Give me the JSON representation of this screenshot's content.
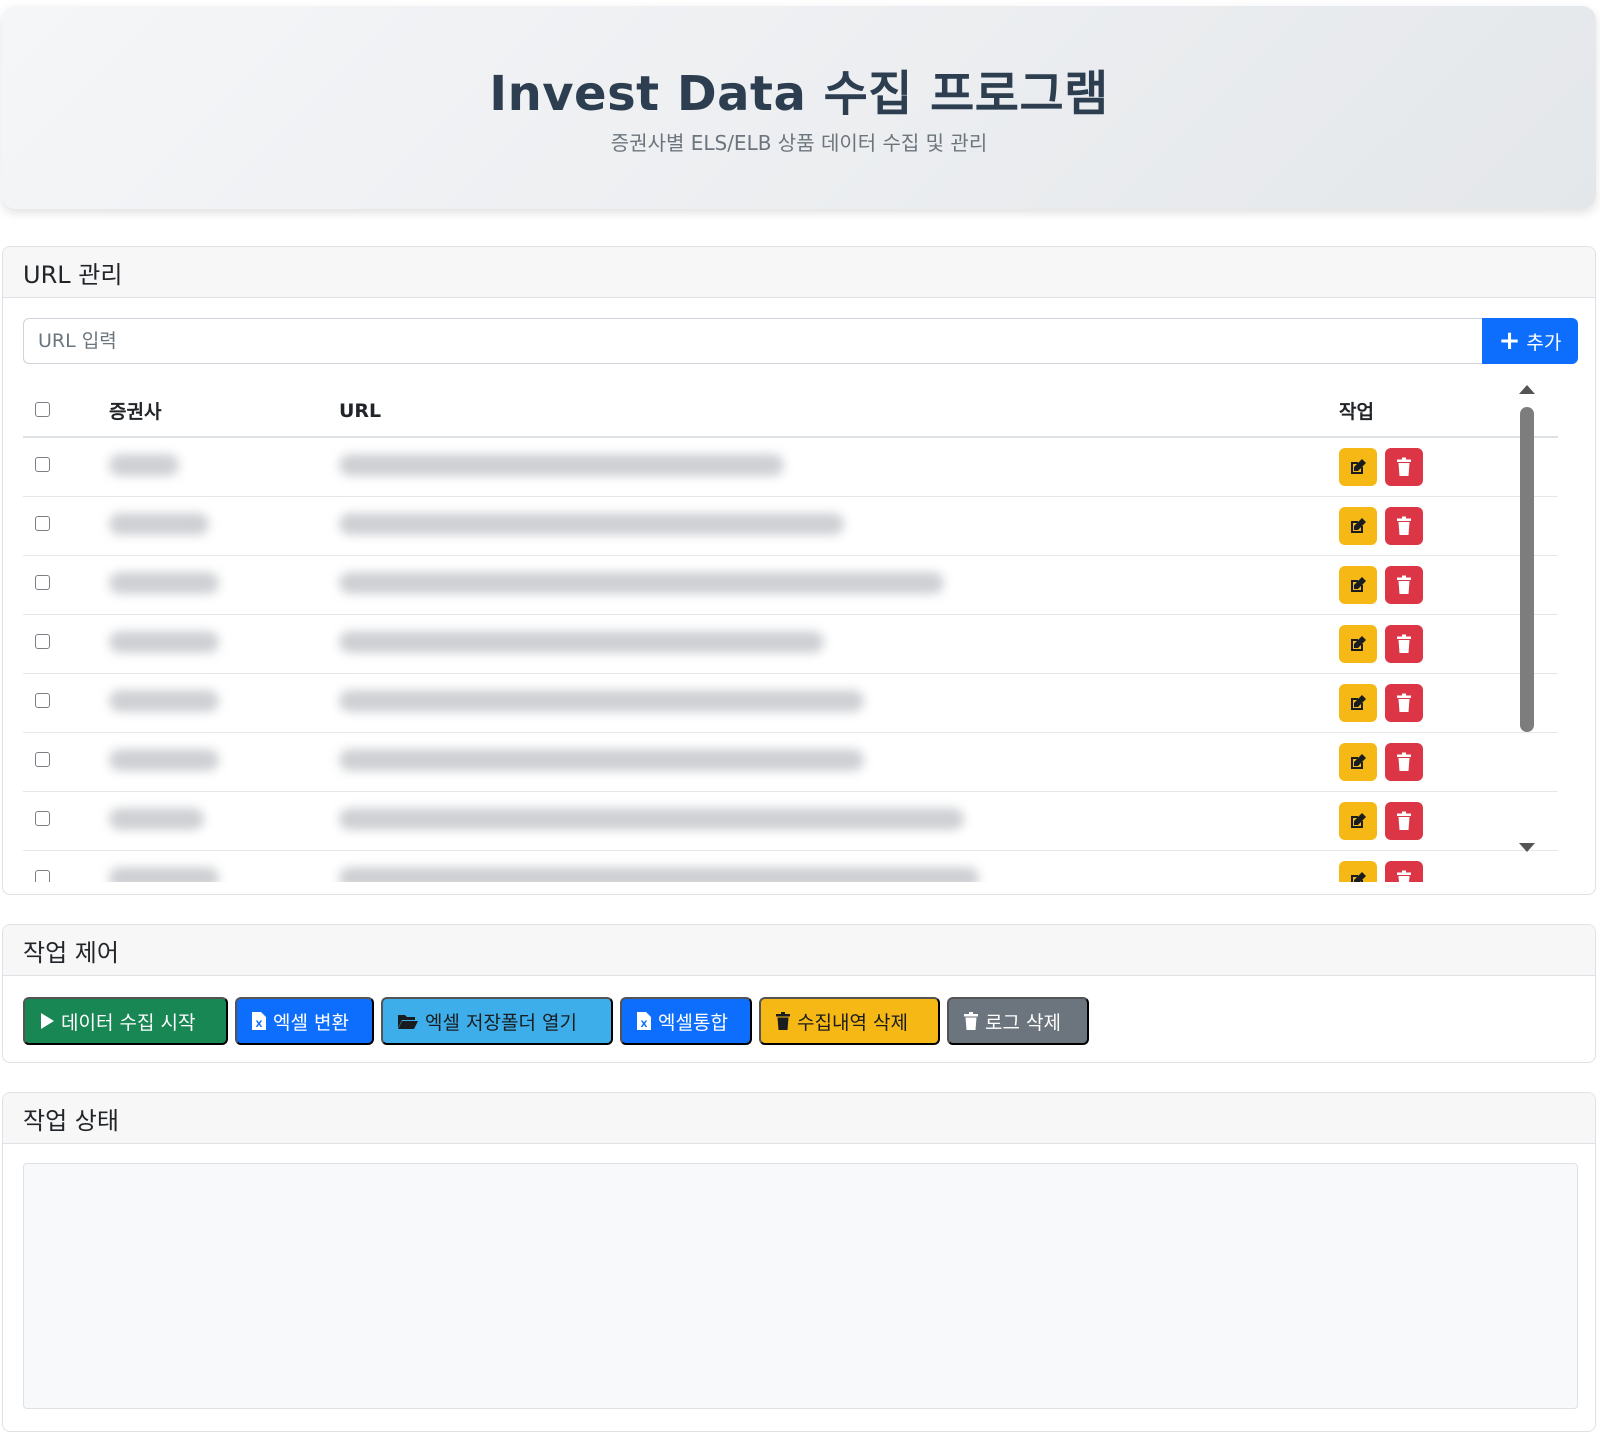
{
  "header": {
    "title": "Invest Data 수집 프로그램",
    "subtitle": "증권사별 ELS/ELB 상품 데이터 수집 및 관리"
  },
  "url_section": {
    "title": "URL 관리",
    "input_placeholder": "URL 입력",
    "add_label": "추가",
    "columns": {
      "company": "증권사",
      "url": "URL",
      "actions": "작업"
    },
    "rows": [
      {
        "company": "",
        "url": "",
        "company_len": 70,
        "url_len": 445
      },
      {
        "company": "",
        "url": "",
        "company_len": 100,
        "url_len": 505
      },
      {
        "company": "",
        "url": "",
        "company_len": 110,
        "url_len": 605
      },
      {
        "company": "",
        "url": "",
        "company_len": 110,
        "url_len": 485
      },
      {
        "company": "",
        "url": "",
        "company_len": 110,
        "url_len": 525
      },
      {
        "company": "",
        "url": "",
        "company_len": 110,
        "url_len": 525
      },
      {
        "company": "",
        "url": "",
        "company_len": 95,
        "url_len": 625
      },
      {
        "company": "",
        "url": "",
        "company_len": 110,
        "url_len": 640
      }
    ]
  },
  "control_section": {
    "title": "작업 제어",
    "buttons": {
      "start": "데이터 수집 시작",
      "excel_convert": "엑셀 변환",
      "open_folder": "엑셀 저장폴더 열기",
      "excel_merge": "엑셀통합",
      "delete_history": "수집내역 삭제",
      "delete_log": "로그 삭제"
    }
  },
  "status_section": {
    "title": "작업 상태",
    "log": ""
  },
  "colors": {
    "primary": "#0d6efd",
    "success": "#198754",
    "info": "#3daee9",
    "warning": "#f5b814",
    "danger": "#dc3545",
    "secondary": "#6c757d"
  }
}
